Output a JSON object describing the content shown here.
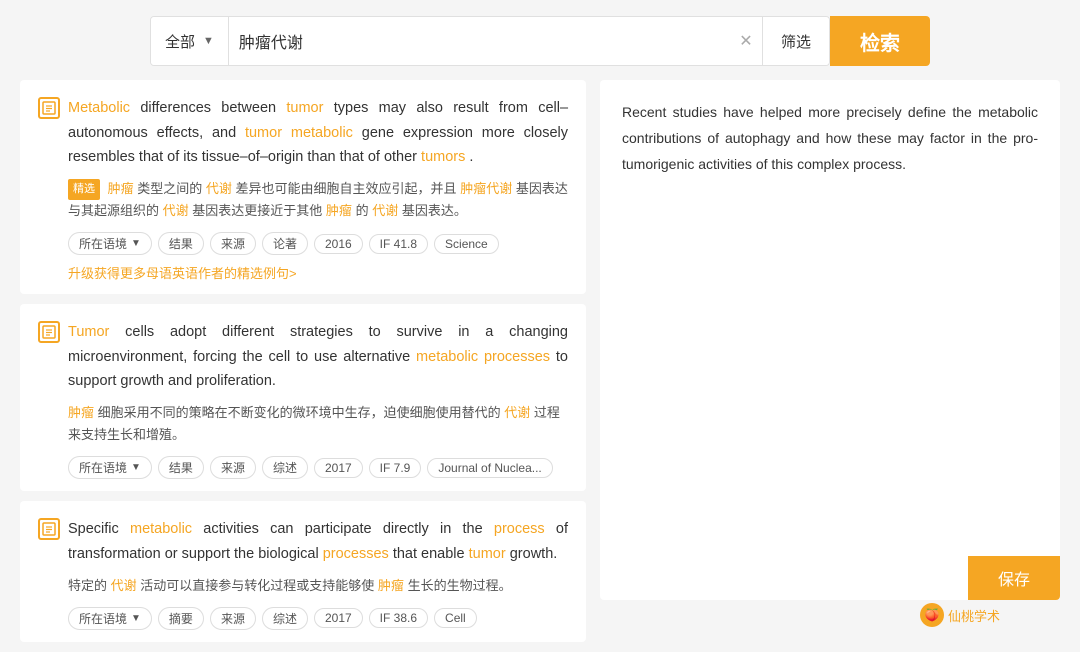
{
  "searchBar": {
    "typeLabel": "全部",
    "queryText": "肿瘤代谢",
    "clearIcon": "×",
    "filterLabel": "筛选",
    "searchLabel": "检索"
  },
  "results": [
    {
      "id": "result-1",
      "englishParts": [
        {
          "text": "Metabolic",
          "highlight": "orange"
        },
        {
          "text": " differences between "
        },
        {
          "text": "tumor",
          "highlight": "orange"
        },
        {
          "text": " types may also result from cell–autonomous effects, and "
        },
        {
          "text": "tumor",
          "highlight": "orange"
        },
        {
          "text": " "
        },
        {
          "text": "metabolic",
          "highlight": "orange"
        },
        {
          "text": " gene expression more closely resembles that of its tissue–of–origin than that of other "
        },
        {
          "text": "tumors",
          "highlight": "link"
        },
        {
          "text": "."
        }
      ],
      "chineseParts": [
        {
          "text": "精选",
          "badge": true
        },
        {
          "text": " "
        },
        {
          "text": "肿瘤",
          "highlight": "orange"
        },
        {
          "text": "类型之间的"
        },
        {
          "text": "代谢",
          "highlight": "orange"
        },
        {
          "text": "差异也可能由细胞自主效应引起，并且"
        },
        {
          "text": "肿瘤代谢",
          "highlight": "orange"
        },
        {
          "text": "基因表达与其起源组织的"
        },
        {
          "text": "代谢",
          "highlight": "orange"
        },
        {
          "text": "基因表达更接近于其他"
        },
        {
          "text": "肿瘤",
          "highlight": "orange"
        },
        {
          "text": "的"
        },
        {
          "text": "代谢",
          "highlight": "orange"
        },
        {
          "text": "基因表达。"
        }
      ],
      "badges": [
        {
          "label": "所在语境",
          "dropdown": true
        },
        {
          "label": "结果"
        },
        {
          "label": "来源"
        },
        {
          "label": "论著"
        },
        {
          "label": "2016"
        },
        {
          "label": "IF 41.8"
        },
        {
          "label": "Science"
        }
      ],
      "upgradeLink": "升级获得更多母语英语作者的精选例句>"
    },
    {
      "id": "result-2",
      "englishParts": [
        {
          "text": "Tumor",
          "highlight": "orange"
        },
        {
          "text": " cells adopt different strategies to survive in a changing microenvironment, forcing the cell to use alternative "
        },
        {
          "text": "metabolic processes",
          "highlight": "link"
        },
        {
          "text": " to support growth and proliferation."
        }
      ],
      "chineseParts": [
        {
          "text": "肿瘤",
          "highlight": "orange"
        },
        {
          "text": "细胞采用不同的策略在不断变化的微环境中生存，迫使细胞使用替代的"
        },
        {
          "text": "代谢",
          "highlight": "orange"
        },
        {
          "text": "过程来支持生长和增殖。"
        }
      ],
      "badges": [
        {
          "label": "所在语境",
          "dropdown": true
        },
        {
          "label": "结果"
        },
        {
          "label": "来源"
        },
        {
          "label": "综述"
        },
        {
          "label": "2017"
        },
        {
          "label": "IF 7.9"
        },
        {
          "label": "Journal of Nuclea..."
        }
      ],
      "upgradeLink": ""
    },
    {
      "id": "result-3",
      "englishParts": [
        {
          "text": "Specific "
        },
        {
          "text": "metabolic",
          "highlight": "orange"
        },
        {
          "text": " activities can participate directly in the "
        },
        {
          "text": "process",
          "highlight": "link"
        },
        {
          "text": " of transformation or support the biological "
        },
        {
          "text": "processes",
          "highlight": "link"
        },
        {
          "text": " that enable "
        },
        {
          "text": "tumor",
          "highlight": "orange"
        },
        {
          "text": " growth."
        }
      ],
      "chineseParts": [
        {
          "text": "特定的"
        },
        {
          "text": "代谢",
          "highlight": "orange"
        },
        {
          "text": "活动可以直接参与转化过程或支持能够使"
        },
        {
          "text": "肿瘤",
          "highlight": "orange"
        },
        {
          "text": "生长的生物过程。"
        }
      ],
      "badges": [
        {
          "label": "所在语境",
          "dropdown": true
        },
        {
          "label": "摘要"
        },
        {
          "label": "来源"
        },
        {
          "label": "综述"
        },
        {
          "label": "2017"
        },
        {
          "label": "IF 38.6"
        },
        {
          "label": "Cell"
        }
      ],
      "upgradeLink": ""
    }
  ],
  "rightPanel": {
    "text": "Recent studies have helped more precisely define the metabolic contributions of autophagy and how these may factor in the pro-tumorigenic activities of this complex process."
  },
  "saveButton": {
    "label": "保存"
  },
  "watermark": {
    "icon": "🍑",
    "text": "仙桃学术"
  }
}
